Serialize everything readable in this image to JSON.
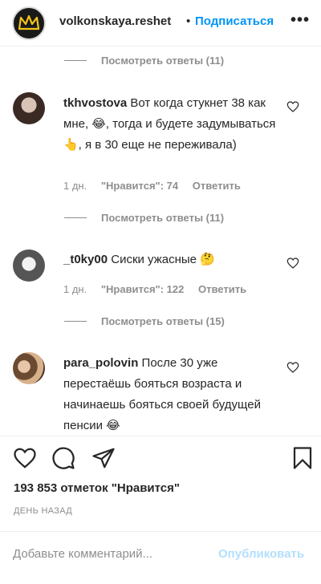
{
  "header": {
    "username": "volkonskaya.reshet",
    "separator": "•",
    "follow_label": "Подписаться",
    "more_icon": "more-horizontal-icon",
    "more_glyph": "•••"
  },
  "replies": [
    {
      "label": "Посмотреть ответы (11)"
    },
    {
      "label": "Посмотреть ответы (11)"
    },
    {
      "label": "Посмотреть ответы (15)"
    }
  ],
  "comments": [
    {
      "username": "tkhvostova",
      "text": "Вот когда стукнет 38 как мне, 😂, тогда и будете задумываться👆, я в 30 еще не переживала)",
      "date": "1 дн.",
      "likes": "\"Нравится\": 74",
      "reply": "Ответить"
    },
    {
      "username": "_t0ky00",
      "text": "Сиски ужасные 🤔",
      "date": "1 дн.",
      "likes": "\"Нравится\": 122",
      "reply": "Ответить"
    },
    {
      "username": "para_polovin",
      "text": "После 30 уже перестаёшь бояться возраста и начинаешь бояться своей будущей пенсии 😂"
    }
  ],
  "post": {
    "likes_count": "193 853 отметок \"Нравится\"",
    "time_ago": "ДЕНЬ НАЗАД"
  },
  "add_comment": {
    "placeholder": "Добавьте комментарий...",
    "publish_label": "Опубликовать"
  },
  "colors": {
    "link": "#0095f6",
    "muted": "#8e8e8e",
    "publish_disabled": "#b2dffc"
  }
}
